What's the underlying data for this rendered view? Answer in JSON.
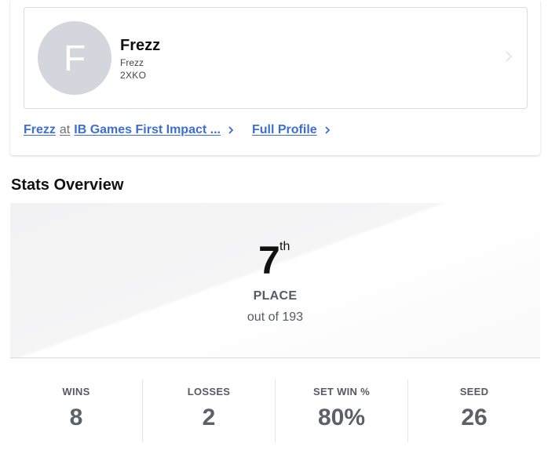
{
  "player": {
    "avatar_letter": "F",
    "name": "Frezz",
    "tag": "Frezz",
    "game": "2XKO"
  },
  "links": {
    "player_link": "Frezz",
    "connector": "at",
    "event_link": "IB Games First Impact ...",
    "full_profile": "Full Profile"
  },
  "section_title": "Stats Overview",
  "placement": {
    "place": "7",
    "suffix": "th",
    "label": "PLACE",
    "out_of": "out of 193"
  },
  "stats": [
    {
      "label": "WINS",
      "value": "8"
    },
    {
      "label": "LOSSES",
      "value": "2"
    },
    {
      "label": "SET WIN %",
      "value": "80%"
    },
    {
      "label": "SEED",
      "value": "26"
    }
  ],
  "colors": {
    "link": "#3b6fd4",
    "avatar_bg": "#d3d6dc",
    "stat_text": "#5b6069"
  },
  "icons": {
    "card_chevron": "chevron-right-icon",
    "link_chevron": "chevron-right-icon"
  }
}
